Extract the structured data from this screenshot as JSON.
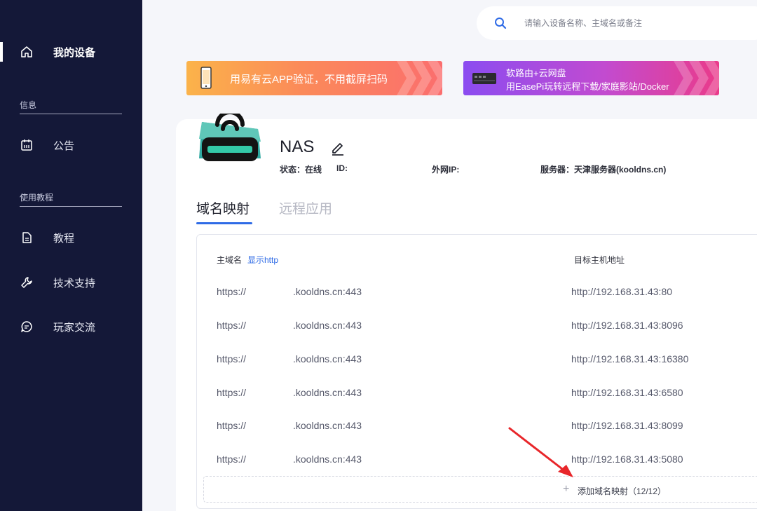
{
  "sidebar": {
    "items": [
      {
        "label": "我的设备",
        "icon": "home-icon",
        "active": true
      },
      {
        "label": "公告",
        "icon": "calendar-icon"
      },
      {
        "label": "教程",
        "icon": "document-icon"
      },
      {
        "label": "技术支持",
        "icon": "wrench-icon"
      },
      {
        "label": "玩家交流",
        "icon": "chat-icon"
      }
    ],
    "sections": {
      "info": "信息",
      "tutorial": "使用教程"
    }
  },
  "search": {
    "placeholder": "请输入设备名称、主域名或备注"
  },
  "banners": {
    "banner1": {
      "text": "用易有云APP验证，不用截屏扫码"
    },
    "banner2": {
      "line1": "软路由+云网盘",
      "line2": "用EasePi玩转远程下载/家庭影站/Docker"
    }
  },
  "device": {
    "name": "NAS",
    "status": "状态：在线",
    "id": "ID:",
    "ip": "外网IP:",
    "server": "服务器：天津服务器(kooldns.cn)"
  },
  "tabs": {
    "domain_mapping": "域名映射",
    "remote_apps": "远程应用"
  },
  "table": {
    "header_domain": "主域名",
    "show_http": "显示http",
    "header_target": "目标主机地址",
    "rows": [
      {
        "prefix": "https://",
        "domain": ".kooldns.cn:443",
        "target": "http://192.168.31.43:80"
      },
      {
        "prefix": "https://",
        "domain": ".kooldns.cn:443",
        "target": "http://192.168.31.43:8096"
      },
      {
        "prefix": "https://",
        "domain": ".kooldns.cn:443",
        "target": "http://192.168.31.43:16380"
      },
      {
        "prefix": "https://",
        "domain": ".kooldns.cn:443",
        "target": "http://192.168.31.43:6580"
      },
      {
        "prefix": "https://",
        "domain": ".kooldns.cn:443",
        "target": "http://192.168.31.43:8099"
      },
      {
        "prefix": "https://",
        "domain": ".kooldns.cn:443",
        "target": "http://192.168.31.43:5080"
      }
    ],
    "add_label": "添加域名映射（12/12）",
    "add_plus": "+"
  },
  "colors": {
    "sidebar_bg": "#141838",
    "accent": "#2f6be6",
    "annotation_arrow": "#e8262a"
  }
}
